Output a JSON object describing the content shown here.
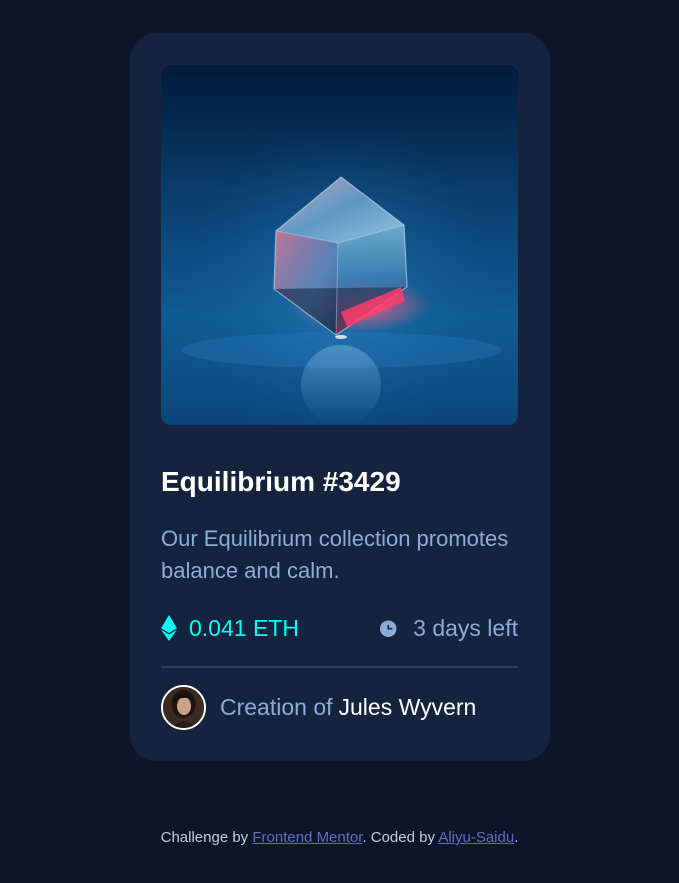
{
  "card": {
    "image_alt": "equilibrium-image",
    "title": "Equilibrium #3429",
    "description": "Our Equilibrium collection promotes balance and calm.",
    "price": "0.041 ETH",
    "time_left": "3 days left",
    "creator_prefix": "Creation of",
    "creator_name": "Jules Wyvern"
  },
  "attribution": {
    "prefix": "Challenge by",
    "challenge_link": "Frontend Mentor",
    "middle": ". Coded by",
    "author_link": "Aliyu-Saidu",
    "suffix": "."
  },
  "colors": {
    "page_background": "#0d1629",
    "card_background": "#15243e",
    "accent_cyan": "#00fff8",
    "soft_blue": "#8bacd9",
    "white": "#ffffff"
  },
  "icons": {
    "price": "ethereum-icon",
    "time": "clock-icon"
  }
}
